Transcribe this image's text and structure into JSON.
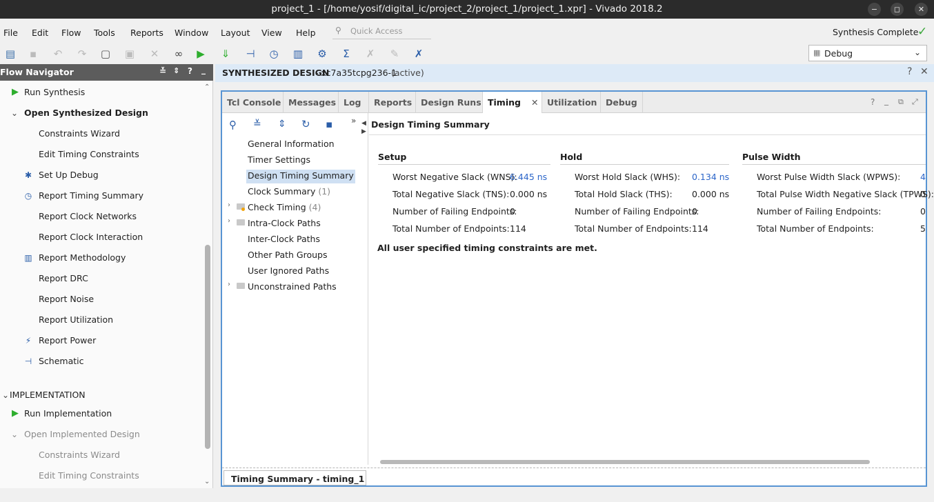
{
  "window": {
    "title": "project_1 - [/home/yosif/digital_ic/project_2/project_1/project_1.xpr] - Vivado 2018.2",
    "minimize": "−",
    "maximize": "◻",
    "close": "✕"
  },
  "menu": {
    "file": "File",
    "edit": "Edit",
    "flow": "Flow",
    "tools": "Tools",
    "reports": "Reports",
    "window": "Window",
    "layout": "Layout",
    "view": "View",
    "help": "Help"
  },
  "quick_access": {
    "placeholder": "Quick Access"
  },
  "status": {
    "text": "Synthesis Complete",
    "color": "#3aa63a"
  },
  "layout_select": {
    "value": "Debug"
  },
  "flow_navigator": {
    "title": "Flow Navigator",
    "items": [
      {
        "label": "Run Synthesis"
      },
      {
        "label": "Open Synthesized Design"
      },
      {
        "label": "Constraints Wizard"
      },
      {
        "label": "Edit Timing Constraints"
      },
      {
        "label": "Set Up Debug"
      },
      {
        "label": "Report Timing Summary"
      },
      {
        "label": "Report Clock Networks"
      },
      {
        "label": "Report Clock Interaction"
      },
      {
        "label": "Report Methodology"
      },
      {
        "label": "Report DRC"
      },
      {
        "label": "Report Noise"
      },
      {
        "label": "Report Utilization"
      },
      {
        "label": "Report Power"
      },
      {
        "label": "Schematic"
      },
      {
        "label": "IMPLEMENTATION"
      },
      {
        "label": "Run Implementation"
      },
      {
        "label": "Open Implemented Design"
      },
      {
        "label": "Constraints Wizard"
      },
      {
        "label": "Edit Timing Constraints"
      }
    ]
  },
  "design_header": {
    "title": "SYNTHESIZED DESIGN",
    "part": " - xc7a35tcpg236-1",
    "state": "(active)"
  },
  "tabs": [
    {
      "label": "Tcl Console"
    },
    {
      "label": "Messages"
    },
    {
      "label": "Log"
    },
    {
      "label": "Reports"
    },
    {
      "label": "Design Runs"
    },
    {
      "label": "Timing"
    },
    {
      "label": "Utilization"
    },
    {
      "label": "Debug"
    }
  ],
  "tree": {
    "header": "Design Timing Summary",
    "items": [
      {
        "label": "General Information"
      },
      {
        "label": "Timer Settings"
      },
      {
        "label": "Design Timing Summary"
      },
      {
        "label": "Clock Summary",
        "count": "(1)"
      },
      {
        "label": "Check Timing",
        "count": "(4)"
      },
      {
        "label": "Intra-Clock Paths"
      },
      {
        "label": "Inter-Clock Paths"
      },
      {
        "label": "Other Path Groups"
      },
      {
        "label": "User Ignored Paths"
      },
      {
        "label": "Unconstrained Paths"
      }
    ]
  },
  "summary": {
    "setup": {
      "title": "Setup",
      "rows": [
        {
          "label": "Worst Negative Slack (WNS):",
          "value": "6.445 ns"
        },
        {
          "label": "Total Negative Slack (TNS):",
          "value": "0.000 ns"
        },
        {
          "label": "Number of Failing Endpoints:",
          "value": "0"
        },
        {
          "label": "Total Number of Endpoints:",
          "value": "114"
        }
      ]
    },
    "hold": {
      "title": "Hold",
      "rows": [
        {
          "label": "Worst Hold Slack (WHS):",
          "value": "0.134 ns"
        },
        {
          "label": "Total Hold Slack (THS):",
          "value": "0.000 ns"
        },
        {
          "label": "Number of Failing Endpoints:",
          "value": "0"
        },
        {
          "label": "Total Number of Endpoints:",
          "value": "114"
        }
      ]
    },
    "pulse": {
      "title": "Pulse Width",
      "rows": [
        {
          "label": "Worst Pulse Width Slack (WPWS):",
          "value": "4"
        },
        {
          "label": "Total Pulse Width Negative Slack (TPWS):",
          "value": "0"
        },
        {
          "label": "Number of Failing Endpoints:",
          "value": "0"
        },
        {
          "label": "Total Number of Endpoints:",
          "value": "5"
        }
      ]
    },
    "message": "All user specified timing constraints are met."
  },
  "bottom_tab": {
    "label": "Timing Summary - timing_1"
  }
}
